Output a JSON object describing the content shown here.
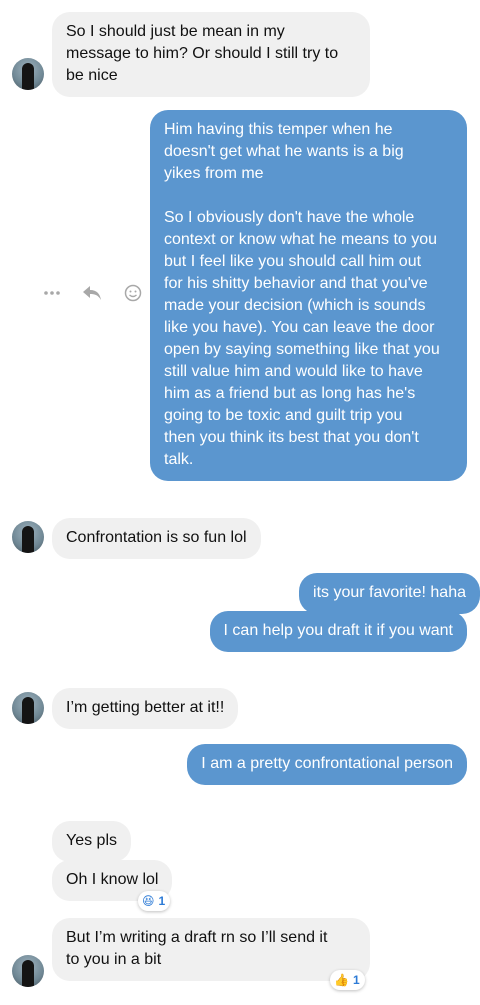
{
  "messages": [
    {
      "id": "m1",
      "text": "So I should just be mean in my\nmessage to him? Or should I still try to\nbe nice"
    },
    {
      "id": "m2",
      "text": "Him having this temper when he\ndoesn't get what he wants is a big\nyikes from me\n\nSo I obviously don't have the whole\ncontext or know what he means to you\nbut I feel like you should call him out\nfor his shitty behavior and that you've\nmade your decision (which is sounds\nlike you have). You can leave the door\nopen by saying something like that you\nstill value him and would like to have\nhim as a friend but as long has he's\ngoing to be toxic and guilt trip you\nthen you think its best that you don't\ntalk."
    },
    {
      "id": "m3",
      "text": "Confrontation is so fun lol"
    },
    {
      "id": "m4",
      "text": "its your favorite! haha"
    },
    {
      "id": "m5",
      "text": "I can help you draft it if you want"
    },
    {
      "id": "m6",
      "text": "I’m getting better at it!!"
    },
    {
      "id": "m7",
      "text": "I am a pretty confrontational person"
    },
    {
      "id": "m8",
      "text": "Yes pls"
    },
    {
      "id": "m9",
      "text": "Oh I know lol"
    },
    {
      "id": "m10",
      "text": "But I’m writing a draft rn so I’ll send it\nto you in a bit"
    }
  ],
  "reactions": [
    {
      "emoji": "😆",
      "count": "1"
    },
    {
      "emoji": "👍",
      "count": "1"
    }
  ],
  "icons": {
    "more": "more-horizontal-icon",
    "reply": "reply-icon",
    "react": "smiley-icon"
  },
  "colors": {
    "outgoing_bubble": "#5b96cf",
    "incoming_bubble": "#f0f0f0",
    "reaction_count": "#2d7bd6"
  }
}
